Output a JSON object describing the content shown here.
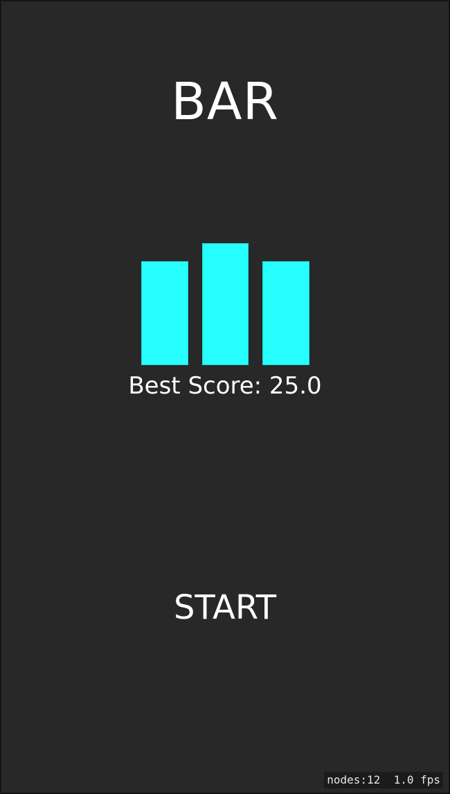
{
  "game": {
    "title": "BAR",
    "best_score_text": "Best Score: 25.0",
    "start_label": "START"
  },
  "logo": {
    "bar_color": "#27fffe",
    "bars": [
      "left",
      "middle",
      "right"
    ]
  },
  "debug": {
    "nodes_text": "nodes:12",
    "fps_text": "1.0 fps"
  },
  "colors": {
    "background": "#282828",
    "text": "#ffffff",
    "accent": "#27fffe"
  }
}
